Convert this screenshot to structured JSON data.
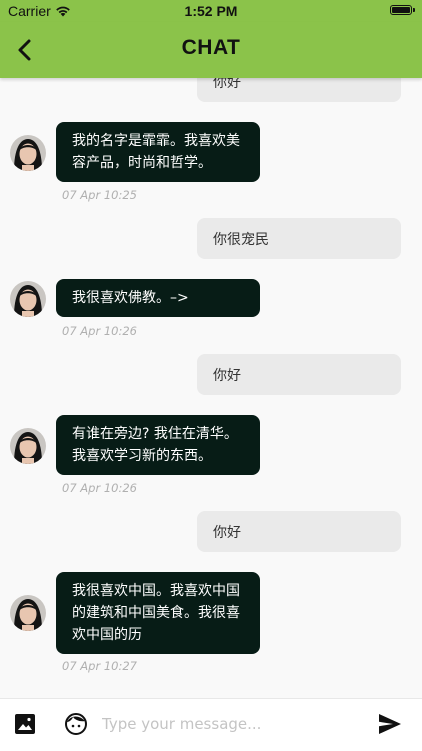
{
  "status_bar": {
    "carrier": "Carrier",
    "time": "1:52 PM"
  },
  "header": {
    "title": "CHAT"
  },
  "messages": [
    {
      "side": "right",
      "text": "你好"
    },
    {
      "side": "left",
      "text_lines": [
        "我的名字是霏霏。我喜欢美",
        "容产品，时尚和哲学。"
      ],
      "time": "07 Apr 10:25"
    },
    {
      "side": "right",
      "text": "你很宠民"
    },
    {
      "side": "left",
      "text_lines": [
        "我很喜欢佛教。–>"
      ],
      "time": "07 Apr 10:26"
    },
    {
      "side": "right",
      "text": "你好"
    },
    {
      "side": "left",
      "text_lines": [
        "有谁在旁边? 我住在清华。",
        "我喜欢学习新的东西。"
      ],
      "time": "07 Apr 10:26"
    },
    {
      "side": "right",
      "text": "你好"
    },
    {
      "side": "left",
      "text_lines": [
        "我很喜欢中国。我喜欢中国",
        "的建筑和中国美食。我很喜",
        "欢中国的历"
      ],
      "time": "07 Apr 10:27"
    }
  ],
  "composer": {
    "placeholder": "Type your message..."
  },
  "icons": {
    "back": "chevron-left-icon",
    "image": "image-icon",
    "sticker": "face-icon",
    "send": "send-icon",
    "wifi": "wifi-icon",
    "battery": "battery-icon"
  },
  "colors": {
    "header": "#8bc34a",
    "bubble_left": "#071c16",
    "bubble_right": "#eaeaea",
    "background": "#f9f9f9"
  }
}
